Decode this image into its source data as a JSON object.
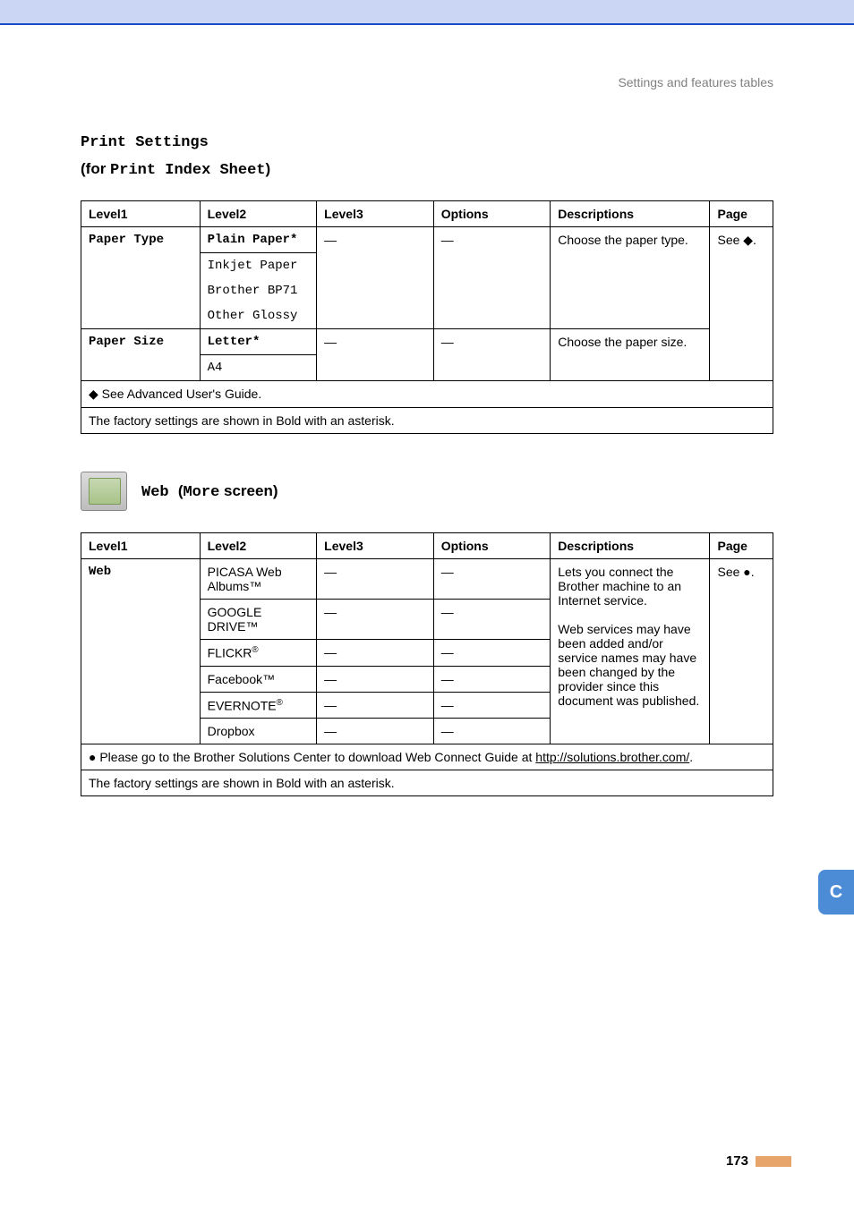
{
  "breadcrumb": "Settings and features tables",
  "heading_title": "Print Settings",
  "heading_subtitle_prefix": "(for ",
  "heading_subtitle_mono": "Print Index Sheet",
  "heading_subtitle_suffix": ")",
  "table1": {
    "headers": {
      "l1": "Level1",
      "l2": "Level2",
      "l3": "Level3",
      "opt": "Options",
      "desc": "Descriptions",
      "page": "Page"
    },
    "rows": {
      "paper_type": {
        "l1": "Paper Type",
        "l2_default": "Plain Paper*",
        "l2_opts": [
          "Inkjet Paper",
          "Brother BP71",
          "Other Glossy"
        ],
        "l3": "—",
        "opt": "—",
        "desc": "Choose the paper type.",
        "page": "See ◆."
      },
      "paper_size": {
        "l1": "Paper Size",
        "l2_default": "Letter*",
        "l2_opts": [
          "A4"
        ],
        "l3": "—",
        "opt": "—",
        "desc": "Choose the paper size."
      }
    },
    "note1": "◆ See Advanced User's Guide.",
    "note2": "The factory settings are shown in Bold with an asterisk."
  },
  "web_heading_mono1": "Web ",
  "web_heading_open": "(",
  "web_heading_mono2": "More",
  "web_heading_rest": " screen)",
  "table2": {
    "headers": {
      "l1": "Level1",
      "l2": "Level2",
      "l3": "Level3",
      "opt": "Options",
      "desc": "Descriptions",
      "page": "Page"
    },
    "l1": "Web",
    "services": {
      "picasa": "PICASA Web Albums™",
      "google": "GOOGLE DRIVE™",
      "flickr_pre": "FLICKR",
      "flickr_sup": "®",
      "facebook": "Facebook™",
      "evernote_pre": "EVERNOTE",
      "evernote_sup": "®",
      "dropbox": "Dropbox"
    },
    "dash": "—",
    "desc_part1": "Lets you connect the Brother machine to an Internet service.",
    "desc_part2": "Web services may have been added and/or service names may have been changed by the provider since this document was published.",
    "page": "See ●.",
    "note1_prefix": "● Please go to the Brother Solutions Center to download Web Connect Guide at ",
    "note1_link": "http://solutions.brother.com/",
    "note1_suffix": ".",
    "note2": "The factory settings are shown in Bold with an asterisk."
  },
  "side_tab": "C",
  "page_number": "173"
}
